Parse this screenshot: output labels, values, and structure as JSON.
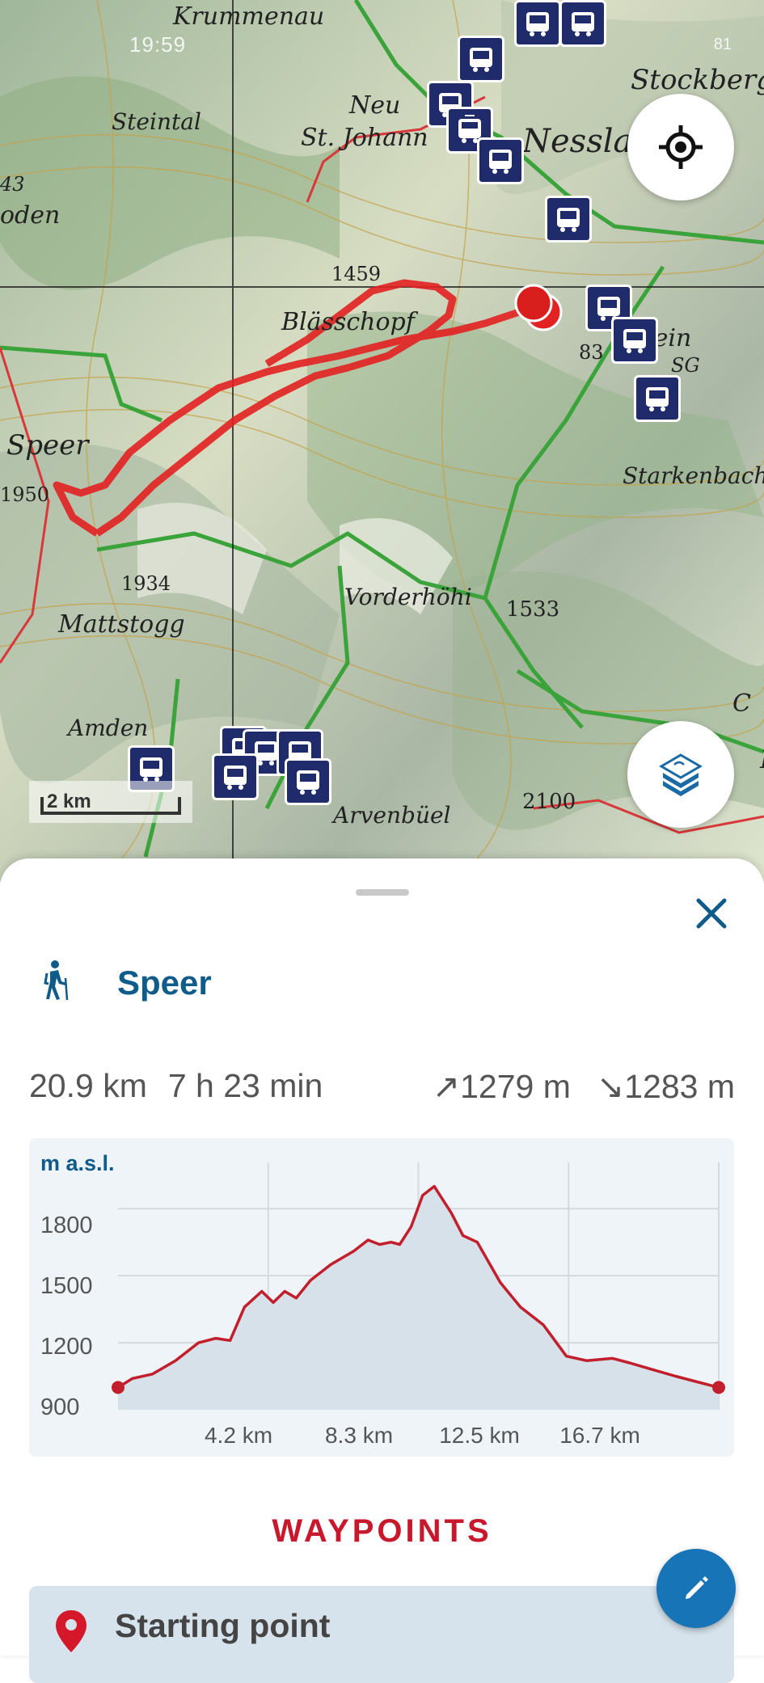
{
  "status_bar": {
    "time": "19:59",
    "battery": "81"
  },
  "map": {
    "scale_label": "2 km",
    "place_labels": [
      "Krummenau",
      "Steintal",
      "Neu St. Johann",
      "Nesslau",
      "Stockberg",
      "Blässchopf",
      "1459",
      "Speer",
      "1950",
      "1934",
      "Mattstogg",
      "Vorderhöhi",
      "1533",
      "Amden",
      "Arvenbüel",
      "Leistchamm",
      "2100",
      "Stein SG",
      "Starkenbach",
      "oden",
      "43",
      "83"
    ]
  },
  "sheet": {
    "route_name": "Speer",
    "distance": "20.9 km",
    "duration": "7 h 23 min",
    "ascent": "1279 m",
    "descent": "1283 m",
    "ascent_arrow": "↗",
    "descent_arrow": "↘",
    "waypoints_title": "WAYPOINTS",
    "first_waypoint": "Starting point"
  },
  "chart_data": {
    "type": "area",
    "ylabel": "m a.s.l.",
    "y_ticks": [
      "1800",
      "1500",
      "1200",
      "900"
    ],
    "x_ticks": [
      "4.2 km",
      "8.3 km",
      "12.5 km",
      "16.7 km"
    ],
    "ylim": [
      900,
      2000
    ],
    "xlim": [
      0,
      20.9
    ],
    "x": [
      0,
      0.5,
      1.2,
      2.0,
      2.8,
      3.4,
      3.9,
      4.4,
      5.0,
      5.4,
      5.8,
      6.2,
      6.7,
      7.4,
      8.2,
      8.7,
      9.1,
      9.5,
      9.8,
      10.2,
      10.6,
      11.0,
      11.6,
      12.0,
      12.5,
      12.9,
      13.3,
      14.0,
      14.8,
      15.6,
      16.3,
      17.2,
      17.8,
      18.6,
      19.4,
      20.9
    ],
    "y": [
      1000,
      1040,
      1060,
      1120,
      1200,
      1220,
      1210,
      1360,
      1430,
      1380,
      1430,
      1400,
      1480,
      1550,
      1610,
      1660,
      1640,
      1650,
      1640,
      1720,
      1860,
      1900,
      1780,
      1680,
      1650,
      1560,
      1470,
      1360,
      1280,
      1140,
      1120,
      1130,
      1110,
      1080,
      1050,
      1000
    ],
    "grid": true
  }
}
